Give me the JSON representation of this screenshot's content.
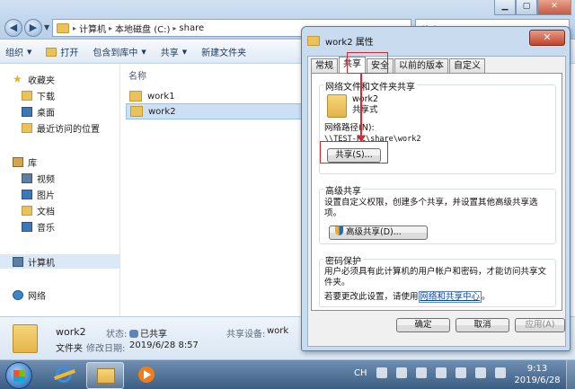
{
  "explorer": {
    "breadcrumbs": [
      "计算机",
      "本地磁盘 (C:)",
      "share"
    ],
    "search_placeholder": "搜索 share",
    "toolbar": [
      {
        "label": "组织",
        "dropdown": true
      },
      {
        "label": "打开",
        "dropdown": false
      },
      {
        "label": "包含到库中",
        "dropdown": true
      },
      {
        "label": "共享",
        "dropdown": true
      },
      {
        "label": "新建文件夹",
        "dropdown": false
      }
    ],
    "nav": {
      "favorites": "收藏夹",
      "downloads": "下载",
      "desktop": "桌面",
      "recent": "最近访问的位置",
      "libraries": "库",
      "videos": "视频",
      "pictures": "图片",
      "documents": "文档",
      "music": "音乐",
      "computer": "计算机",
      "network": "网络"
    },
    "column_header": "名称",
    "files": [
      {
        "name": "work1",
        "selected": false
      },
      {
        "name": "work2",
        "selected": true
      }
    ],
    "details": {
      "name": "work2",
      "type": "文件夹",
      "state_label": "状态:",
      "state_value": "已共享",
      "share_label": "共享设备:",
      "share_value": "work",
      "modified_label": "修改日期:",
      "modified_value": "2019/6/28 8:57"
    }
  },
  "dialog": {
    "title": "work2 属性",
    "close_label": "✕",
    "tabs": [
      {
        "label": "常规",
        "active": false
      },
      {
        "label": "共享",
        "active": true
      },
      {
        "label": "安全",
        "active": false
      },
      {
        "label": "以前的版本",
        "active": false
      },
      {
        "label": "自定义",
        "active": false
      }
    ],
    "network_group": {
      "title": "网络文件和文件夹共享",
      "folder_name": "work2",
      "share_status": "共享式",
      "path_label": "网络路径(N):",
      "path_value": "\\\\TEST-PC\\share\\work2",
      "share_button": "共享(S)..."
    },
    "advanced_group": {
      "title": "高级共享",
      "description": "设置自定义权限，创建多个共享，并设置其他高级共享选项。",
      "button": "高级共享(D)..."
    },
    "password_group": {
      "title": "密码保护",
      "description": "用户必须具有此计算机的用户帐户和密码，才能访问共享文件夹。",
      "change_prefix": "若要更改此设置，请使用",
      "change_link": "网络和共享中心",
      "change_suffix": "。"
    },
    "buttons": {
      "ok": "确定",
      "cancel": "取消",
      "apply": "应用(A)"
    }
  },
  "taskbar": {
    "language": "CH",
    "time": "9:13",
    "date": "2019/6/28"
  },
  "colors": {
    "highlight": "#e0262b",
    "link": "#0645ad",
    "selection": "#cce0f5"
  }
}
